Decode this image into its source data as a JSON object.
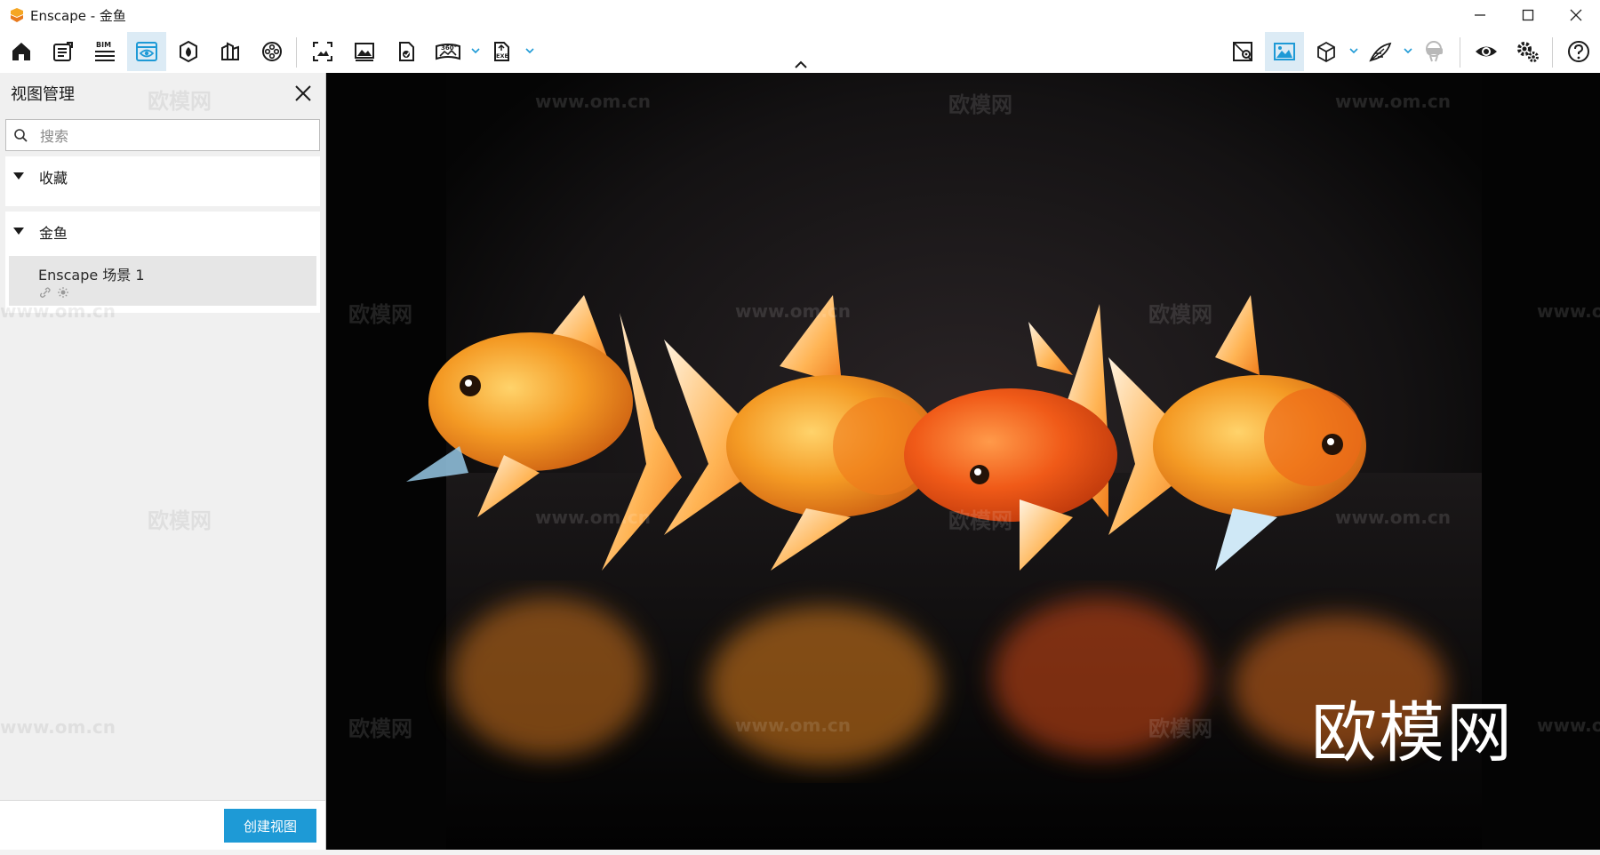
{
  "window": {
    "title": "Enscape - 金鱼",
    "controls": [
      "minimize-icon",
      "maximize-icon",
      "close-icon"
    ]
  },
  "toolbar": {
    "left_tools": [
      {
        "name": "home-icon"
      },
      {
        "name": "document-list-icon"
      },
      {
        "name": "bim-icon",
        "text": "BIM"
      },
      {
        "name": "view-management-icon",
        "active": true
      },
      {
        "name": "asset-library-icon"
      },
      {
        "name": "material-editor-icon"
      },
      {
        "name": "video-reel-icon"
      },
      {
        "name": "screenshot-icon"
      },
      {
        "name": "gallery-icon"
      },
      {
        "name": "batch-render-icon"
      },
      {
        "name": "panorama-360-icon",
        "text": "360°"
      },
      {
        "name": "export-exe-icon",
        "text": "EXE"
      }
    ],
    "right_tools": [
      {
        "name": "map-pin-icon"
      },
      {
        "name": "image-settings-icon",
        "active": true
      },
      {
        "name": "cube-view-icon"
      },
      {
        "name": "feather-icon"
      },
      {
        "name": "vr-headset-icon"
      },
      {
        "name": "visibility-icon"
      },
      {
        "name": "settings-icon"
      },
      {
        "name": "help-icon"
      }
    ],
    "accent_color": "#1e9ad6"
  },
  "panel": {
    "title": "视图管理",
    "search_placeholder": "搜索",
    "sections": [
      {
        "label": "收藏",
        "expanded": true,
        "items": []
      },
      {
        "label": "金鱼",
        "expanded": true,
        "items": [
          {
            "name": "Enscape 场景 1",
            "icons": [
              "link-icon",
              "sun-icon"
            ]
          }
        ]
      }
    ],
    "create_button": "创建视图"
  },
  "viewport": {
    "scene": "goldfish render",
    "watermark_small": "欧模网",
    "watermark_url": "www.om.cn",
    "watermark_large": "欧模网"
  }
}
